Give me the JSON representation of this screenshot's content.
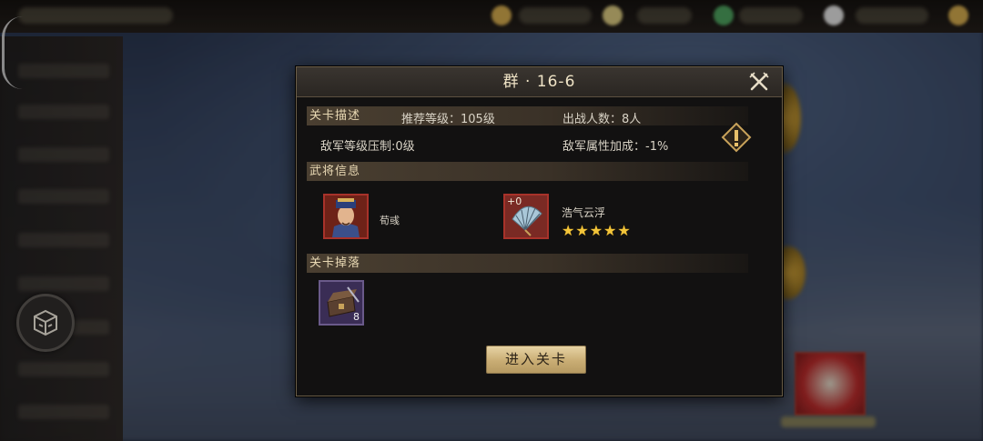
{
  "dialog": {
    "title": "群 · 16-6",
    "description": {
      "section_label": "关卡描述",
      "recommended_level": "推荐等级：105级",
      "troop_count": "出战人数：8人",
      "enemy_level_suppression": "敌军等级压制:0级",
      "enemy_attribute_bonus": "敌军属性加成：-1%"
    },
    "general_info": {
      "section_label": "武将信息",
      "general_name": "荀彧",
      "equipment_name": "浩气云浮",
      "equipment_plus": "+0",
      "equipment_stars": 5
    },
    "drops": {
      "section_label": "关卡掉落",
      "item_count": "8"
    },
    "enter_button_label": "进入关卡"
  },
  "icons": {
    "close": "close-icon",
    "warning": "warning-icon",
    "menu": "menu-icon"
  },
  "colors": {
    "accent_gold": "#c9ad74",
    "star_gold": "#f3c53a",
    "general_frame_red": "#a8322a",
    "item_frame_purple": "#6a5a8a"
  }
}
